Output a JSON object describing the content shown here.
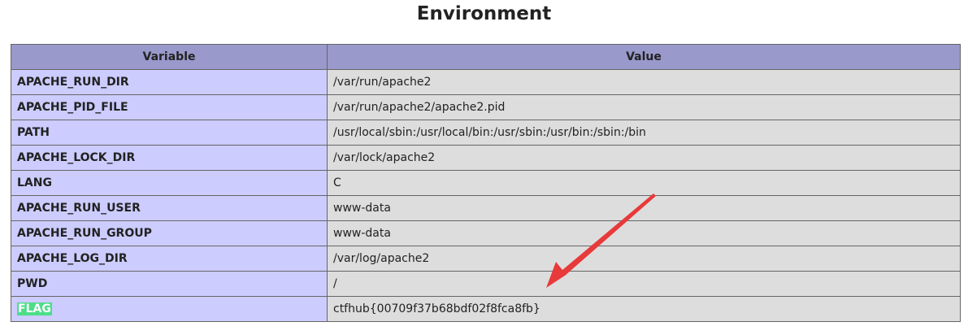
{
  "page": {
    "title": "Environment"
  },
  "table": {
    "headers": [
      "Variable",
      "Value"
    ],
    "rows": [
      {
        "name": "APACHE_RUN_DIR",
        "value": "/var/run/apache2"
      },
      {
        "name": "APACHE_PID_FILE",
        "value": "/var/run/apache2/apache2.pid"
      },
      {
        "name": "PATH",
        "value": "/usr/local/sbin:/usr/local/bin:/usr/sbin:/usr/bin:/sbin:/bin"
      },
      {
        "name": "APACHE_LOCK_DIR",
        "value": "/var/lock/apache2"
      },
      {
        "name": "LANG",
        "value": "C"
      },
      {
        "name": "APACHE_RUN_USER",
        "value": "www-data"
      },
      {
        "name": "APACHE_RUN_GROUP",
        "value": "www-data"
      },
      {
        "name": "APACHE_LOG_DIR",
        "value": "/var/log/apache2"
      },
      {
        "name": "PWD",
        "value": "/"
      },
      {
        "name": "FLAG",
        "value": "ctfhub{00709f37b68bdf02f8fca8fb}"
      }
    ]
  },
  "colors": {
    "header_bg": "#9999cc",
    "key_bg": "#ccccff",
    "value_bg": "#dddddd",
    "highlight": "#4ede8a",
    "arrow": "#e8393b"
  },
  "annotation": {
    "icon": "red-arrow-icon"
  }
}
